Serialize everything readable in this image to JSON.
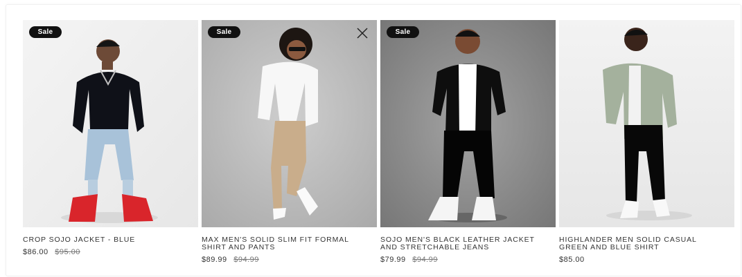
{
  "products": [
    {
      "badge": "Sale",
      "title": "CROP SOJO JACKET - BLUE",
      "price": "$86.00",
      "old_price": "$95.00",
      "bg": "#efefef"
    },
    {
      "badge": "Sale",
      "title": "MAX MEN'S SOLID SLIM FIT FORMAL\nSHIRT AND PANTS",
      "price": "$89.99",
      "old_price": "$94.99",
      "bg": "#bdbdbd"
    },
    {
      "badge": "Sale",
      "title": "SOJO MEN'S BLACK LEATHER JACKET\nAND STRETCHABLE JEANS",
      "price": "$79.99",
      "old_price": "$94.99",
      "bg": "#8f8f8f"
    },
    {
      "badge": "",
      "title": "HIGHLANDER MEN SOLID CASUAL\nGREEN AND BLUE SHIRT",
      "price": "$85.00",
      "old_price": "",
      "bg": "#eeeeee"
    }
  ]
}
